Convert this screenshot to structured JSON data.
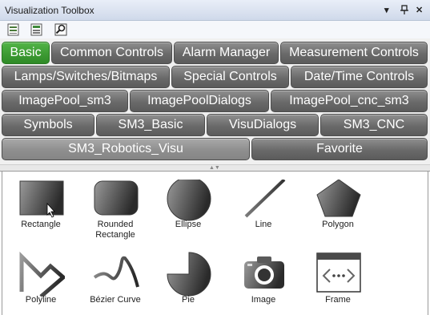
{
  "window": {
    "title": "Visualization Toolbox",
    "controls": {
      "dropdown": "▾",
      "pin": "ᵖ",
      "close": "✕"
    }
  },
  "toolbar": {
    "tools": [
      {
        "icon": "list-view-icon"
      },
      {
        "icon": "list-view-alt-icon"
      },
      {
        "icon": "search-icon"
      }
    ]
  },
  "tabs": [
    {
      "label": "Basic",
      "active": true
    },
    {
      "label": "Common Controls"
    },
    {
      "label": "Alarm Manager"
    },
    {
      "label": "Measurement Controls"
    },
    {
      "label": "Lamps/Switches/Bitmaps"
    },
    {
      "label": "Special Controls"
    },
    {
      "label": "Date/Time Controls"
    },
    {
      "label": "ImagePool_sm3"
    },
    {
      "label": "ImagePoolDialogs"
    },
    {
      "label": "ImagePool_cnc_sm3"
    },
    {
      "label": "Symbols"
    },
    {
      "label": "SM3_Basic"
    },
    {
      "label": "VisuDialogs"
    },
    {
      "label": "SM3_CNC"
    },
    {
      "label": "SM3_Robotics_Visu"
    },
    {
      "label": "Favorite"
    }
  ],
  "items": [
    {
      "label": "Rectangle",
      "icon": "rectangle-icon"
    },
    {
      "label": "Rounded Rectangle",
      "icon": "rounded-rectangle-icon"
    },
    {
      "label": "Ellipse",
      "icon": "ellipse-icon"
    },
    {
      "label": "Line",
      "icon": "line-icon"
    },
    {
      "label": "Polygon",
      "icon": "polygon-icon"
    },
    {
      "label": "Polyline",
      "icon": "polyline-icon"
    },
    {
      "label": "Bézier Curve",
      "icon": "bezier-curve-icon"
    },
    {
      "label": "Pie",
      "icon": "pie-icon"
    },
    {
      "label": "Image",
      "icon": "image-icon"
    },
    {
      "label": "Frame",
      "icon": "frame-icon"
    }
  ],
  "colors": {
    "active_tab": "#3d9b33",
    "tab": "#6a6a6a",
    "titlebar": "#cfd9ea"
  }
}
